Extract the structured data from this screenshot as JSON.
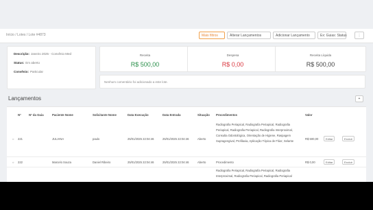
{
  "breadcrumb": "Início / Lotes / Lote #4873",
  "toolbar": {
    "filter_label": "Mais filtros",
    "alter_label": "Alterar Lançamentos",
    "add_label": "Adicionar Lançamento",
    "select_value": "Ex: Guias: Status",
    "more_label": "⋮"
  },
  "info": {
    "descricao_label": "Descrição:",
    "descricao_value": "Janeiro 2025 - Convênio Med",
    "status_label": "Status:",
    "status_value": "Em aberto",
    "convenio_label": "Convênio:",
    "convenio_value": "Particular"
  },
  "kpis": [
    {
      "label": "Receita",
      "value": "R$ 500,00",
      "color": "#2a8f4a"
    },
    {
      "label": "Despesa",
      "value": "R$ 0,00",
      "color": "#d9363e"
    },
    {
      "label": "Receita Líquida",
      "value": "R$ 500,00",
      "color": "#444444"
    }
  ],
  "note": "Nenhum comentário foi adicionado a este lote.",
  "section_title": "Lançamentos",
  "corner_label": "+",
  "headers": [
    "Nº",
    "Nº da Guia",
    "Paciente Nome",
    "Solicitante Nome",
    "Data Execução",
    "Data Entrada",
    "Situação",
    "Procedimentos",
    "Valor"
  ],
  "rows": [
    {
      "id": "221",
      "guia": "",
      "paciente": "JULIANA",
      "solicitante": "paulo",
      "exec": "25/01/2025 22:04:46",
      "entrada": "25/01/2025 22:04:46",
      "situacao": "Aberto",
      "procedimentos": "Radiografia Periapical, Radiografia Periapical, Radiografia Periapical, Radiografia Periapical, Radiografia Interproximal, Consulta Odontológica, Orientação de Higiene, Raspagem Supragengival, Profilaxia, Aplicação Tópica de Flúor, Selante",
      "valor": "R$ 500,00",
      "edit": "Editar",
      "delete": "Excluir"
    },
    {
      "id": "222",
      "guia": "",
      "paciente": "Marcelo Souza",
      "solicitante": "Daniel Ribeiro",
      "exec": "25/01/2025 22:04:46",
      "entrada": "25/01/2025 22:04:46",
      "situacao": "Aberto",
      "procedimentos": "Procedimento",
      "valor": "R$ 0,00",
      "edit": "Editar",
      "delete": "Excluir"
    }
  ],
  "extra_text": "Radiografia Periapical, Radiografia Periapical, Radiografia Interproximal, Radiografia Periapical, Radiografia Periapical"
}
